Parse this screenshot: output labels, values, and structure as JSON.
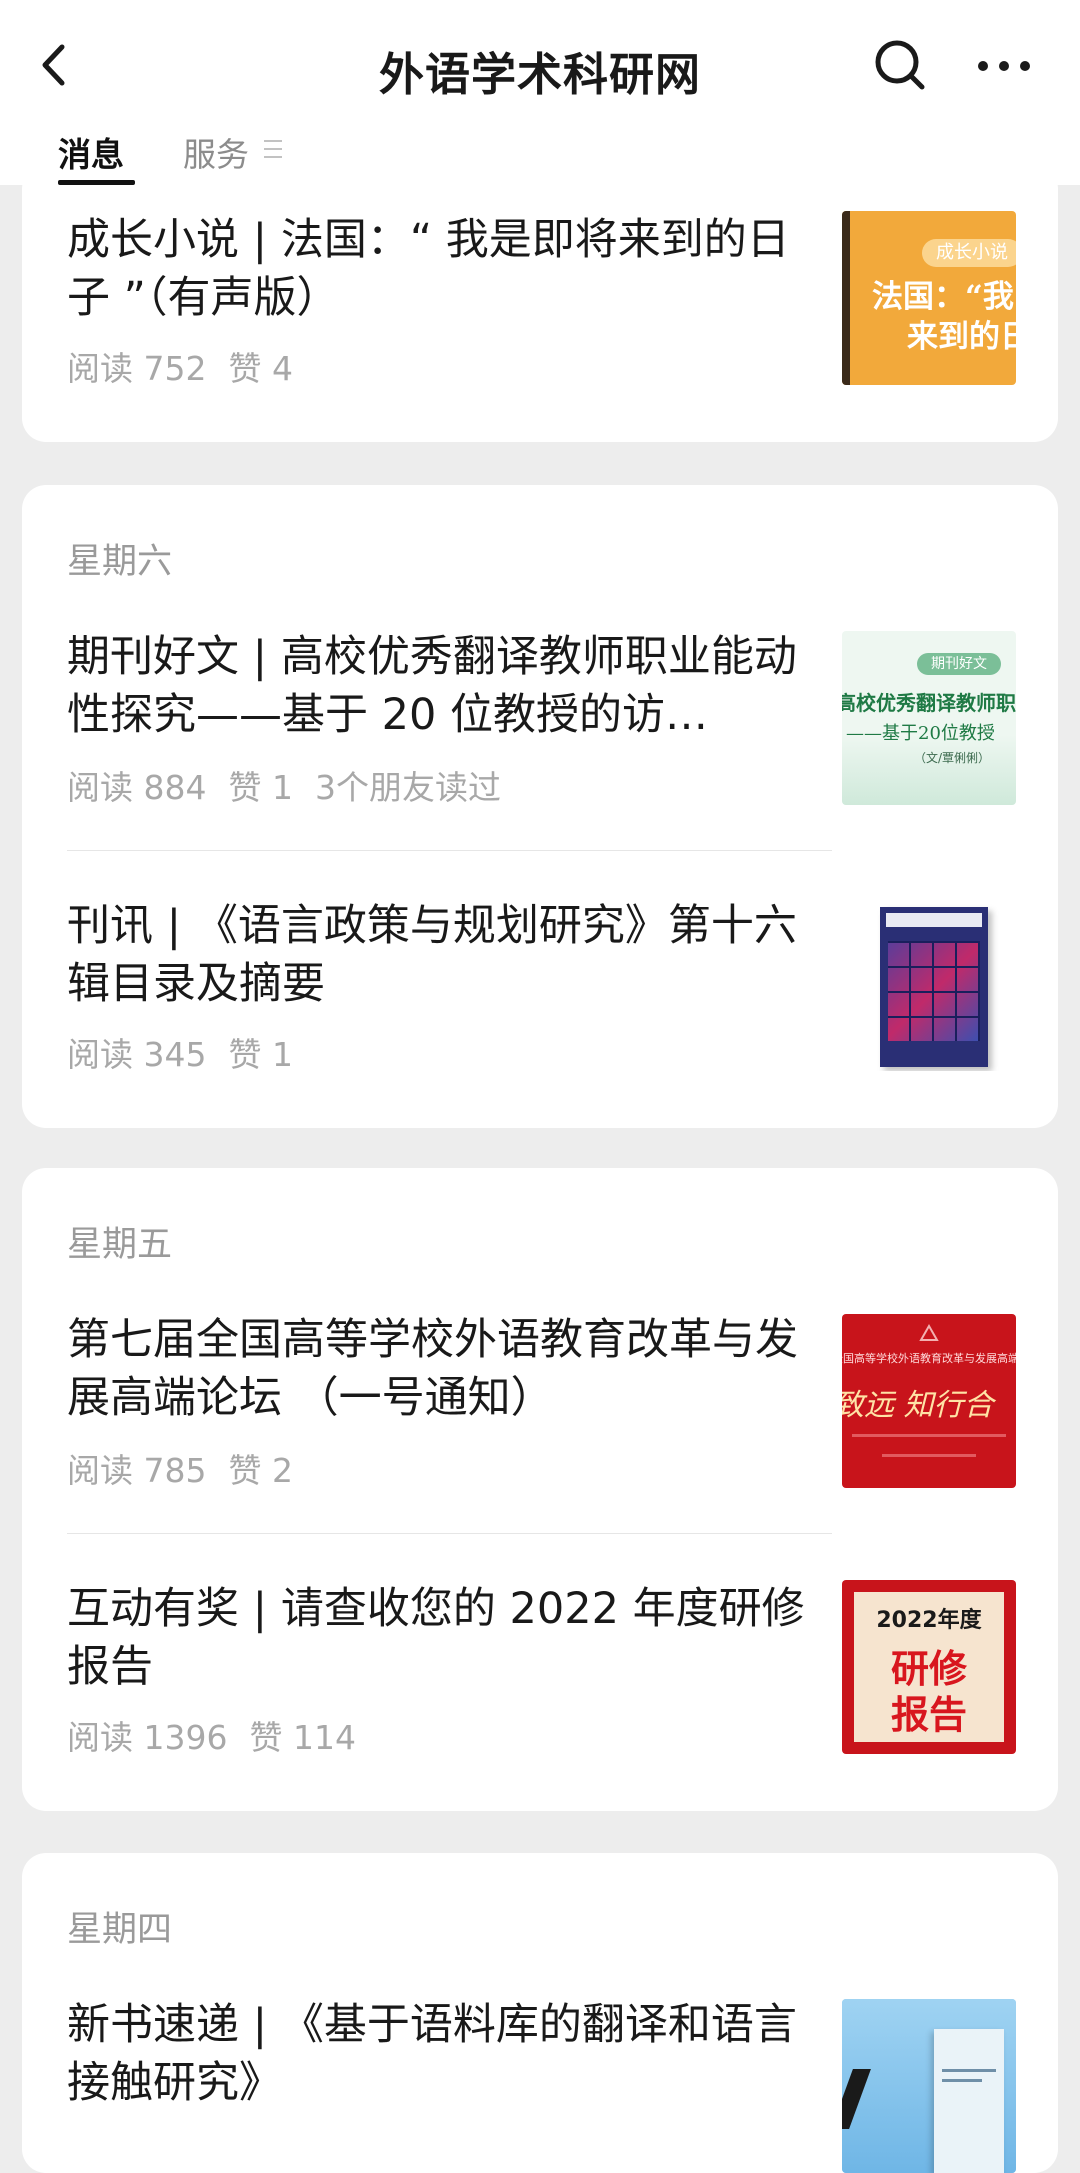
{
  "header": {
    "title": "外语学术科研网",
    "tabs": [
      {
        "label": "消息",
        "active": true
      },
      {
        "label": "服务",
        "active": false
      }
    ]
  },
  "thumbnails": {
    "novel": {
      "tag": "成长小说",
      "line1": "法国：“我",
      "line2": "来到的日"
    },
    "journal": {
      "tag": "期刊好文",
      "line1": "高校优秀翻译教师职业",
      "line2": "——基于20位教授",
      "line3": "（文/覃俐俐）"
    },
    "forum": {
      "line1": "全国高等学校外语教育改革与发展高端",
      "slogan": "致远 知行合"
    },
    "report": {
      "year": "2022年度",
      "line1": "研修",
      "line2": "报告"
    }
  },
  "feed": [
    {
      "day": "",
      "articles": [
        {
          "title": "成长小说 | 法国：“ 我是即将来到的日子 ”（有声版）",
          "reads": "阅读 752",
          "likes": "赞 4",
          "extra": ""
        }
      ]
    },
    {
      "day": "星期六",
      "articles": [
        {
          "title": "期刊好文 | 高校优秀翻译教师职业能动性探究——基于 20 位教授的访…",
          "reads": "阅读 884",
          "likes": "赞 1",
          "extra": "3个朋友读过"
        },
        {
          "title": "刊讯 | 《语言政策与规划研究》第十六辑目录及摘要",
          "reads": "阅读 345",
          "likes": "赞 1",
          "extra": ""
        }
      ]
    },
    {
      "day": "星期五",
      "articles": [
        {
          "title": "第七届全国高等学校外语教育改革与发展高端论坛 （一号通知）",
          "reads": "阅读 785",
          "likes": "赞 2",
          "extra": ""
        },
        {
          "title": "互动有奖 | 请查收您的 2022 年度研修报告",
          "reads": "阅读 1396",
          "likes": "赞 114",
          "extra": ""
        }
      ]
    },
    {
      "day": "星期四",
      "articles": [
        {
          "title": "新书速递 | 《基于语料库的翻译和语言接触研究》",
          "reads": "",
          "likes": "",
          "extra": ""
        }
      ]
    }
  ],
  "colors": {
    "background": "#ededed",
    "card": "#ffffff",
    "meta_text": "#a8a8a8",
    "thumb_orange": "#f2a93b",
    "thumb_green": "#dff0e6",
    "thumb_red": "#c8141b",
    "thumb_blue": "#8cc8ee"
  },
  "icons": [
    "back-arrow-icon",
    "search-icon",
    "more-icon",
    "menu-lines-icon"
  ]
}
